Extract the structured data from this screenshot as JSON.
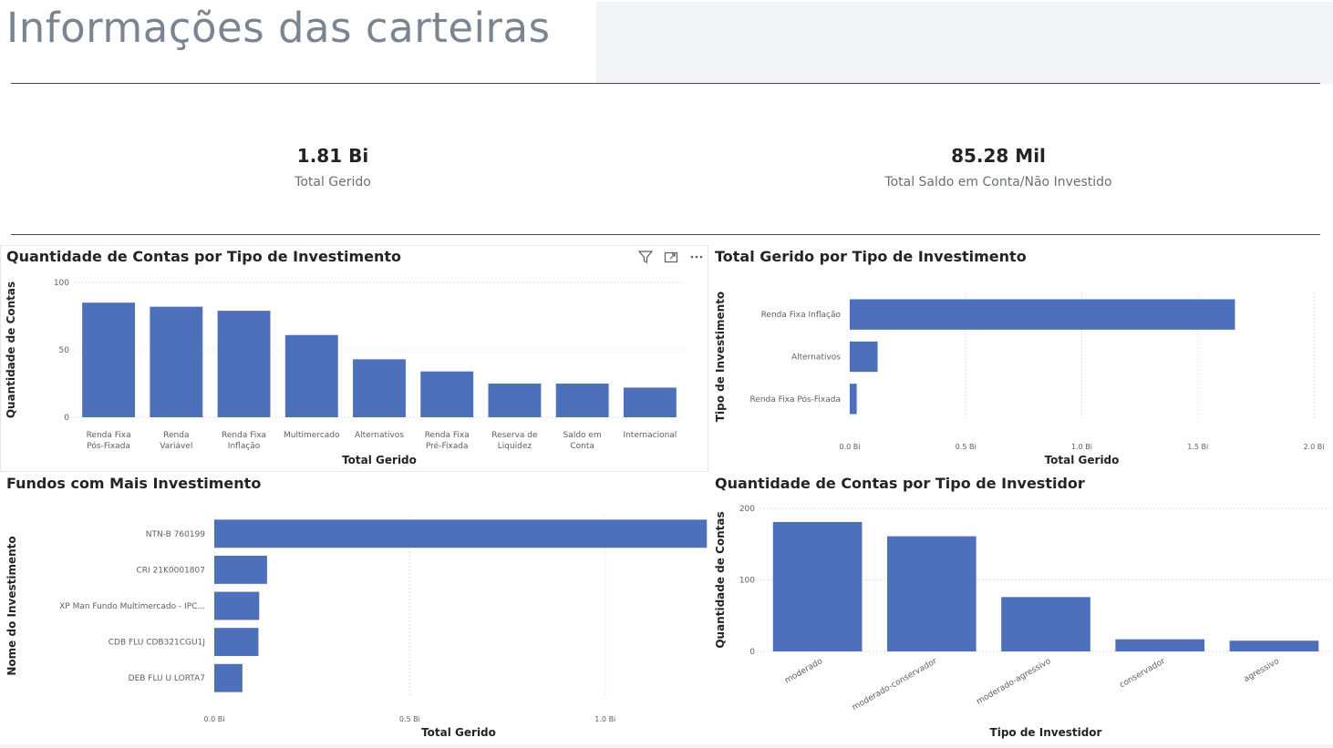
{
  "page_title": "Informações das carteiras",
  "kpis": [
    {
      "value": "1.81 Bi",
      "label": "Total Gerido"
    },
    {
      "value": "85.28 Mil",
      "label": "Total Saldo em Conta/Não Investido"
    }
  ],
  "visual_header": {
    "filter_icon": "filter-icon",
    "focus_icon": "focus-mode-icon",
    "more_icon": "more-options-icon"
  },
  "colors": {
    "bar": "#4e6fba",
    "grid": "#c8c8c8",
    "axis_text": "#605e5c"
  },
  "chart_data": [
    {
      "type": "bar",
      "title": "Quantidade de Contas por Tipo de Investimento",
      "xlabel": "Total Gerido",
      "ylabel": "Quantidade de Contas",
      "categories": [
        "Renda Fixa Pós-Fixada",
        "Renda Variável",
        "Renda Fixa Inflação",
        "Multimercado",
        "Alternativos",
        "Renda Fixa Pré-Fixada",
        "Reserva de Liquidez",
        "Saldo em Conta",
        "Internacional"
      ],
      "category_lines": [
        [
          "Renda Fixa",
          "Pós-Fixada"
        ],
        [
          "Renda",
          "Variável"
        ],
        [
          "Renda Fixa",
          "Inflação"
        ],
        [
          "Multimercado"
        ],
        [
          "Alternativos"
        ],
        [
          "Renda Fixa",
          "Pré-Fixada"
        ],
        [
          "Reserva de",
          "Liquidez"
        ],
        [
          "Saldo em",
          "Conta"
        ],
        [
          "Internacional"
        ]
      ],
      "values": [
        85,
        82,
        79,
        61,
        43,
        34,
        25,
        25,
        22
      ],
      "ylim": [
        0,
        100
      ],
      "yticks": [
        0,
        50,
        100
      ],
      "ytick_labels": [
        "0",
        "50",
        "100"
      ],
      "grid": true
    },
    {
      "type": "bar",
      "orientation": "horizontal",
      "title": "Total Gerido por Tipo de Investimento",
      "xlabel": "Total Gerido",
      "ylabel": "Tipo de Investimento",
      "categories": [
        "Renda Fixa Inflação",
        "Alternativos",
        "Renda Fixa Pós-Fixada"
      ],
      "values": [
        1.66,
        0.12,
        0.03
      ],
      "unit": "Bi",
      "xlim": [
        0,
        2.0
      ],
      "xticks": [
        0,
        0.5,
        1.0,
        1.5,
        2.0
      ],
      "xtick_labels": [
        "0.0 Bi",
        "0.5 Bi",
        "1.0 Bi",
        "1.5 Bi",
        "2.0 Bi"
      ],
      "grid": true
    },
    {
      "type": "bar",
      "orientation": "horizontal",
      "title": "Fundos com Mais Investimento",
      "xlabel": "Total Gerido",
      "ylabel": "Nome do Investimento",
      "categories": [
        "NTN-B 760199",
        "CRI 21K0001807",
        "XP Man Fundo Multimercado - IPC...",
        "CDB FLU CDB321CGU1J",
        "DEB FLU U LORTA7"
      ],
      "values": [
        1.26,
        0.135,
        0.115,
        0.113,
        0.072
      ],
      "unit": "Bi",
      "xlim": [
        0,
        1.25
      ],
      "xticks": [
        0,
        0.5,
        1.0
      ],
      "xtick_labels": [
        "0.0 Bi",
        "0.5 Bi",
        "1.0 Bi"
      ],
      "grid": true
    },
    {
      "type": "bar",
      "title": "Quantidade de Contas por Tipo de Investidor",
      "xlabel": "Tipo de Investidor",
      "ylabel": "Quantidade de Contas",
      "categories": [
        "moderado",
        "moderado-conservador",
        "moderado-agressivo",
        "conservador",
        "agressivo"
      ],
      "values": [
        181,
        161,
        76,
        17,
        15
      ],
      "ylim": [
        0,
        200
      ],
      "yticks": [
        0,
        100,
        200
      ],
      "ytick_labels": [
        "0",
        "100",
        "200"
      ],
      "grid": true
    }
  ]
}
